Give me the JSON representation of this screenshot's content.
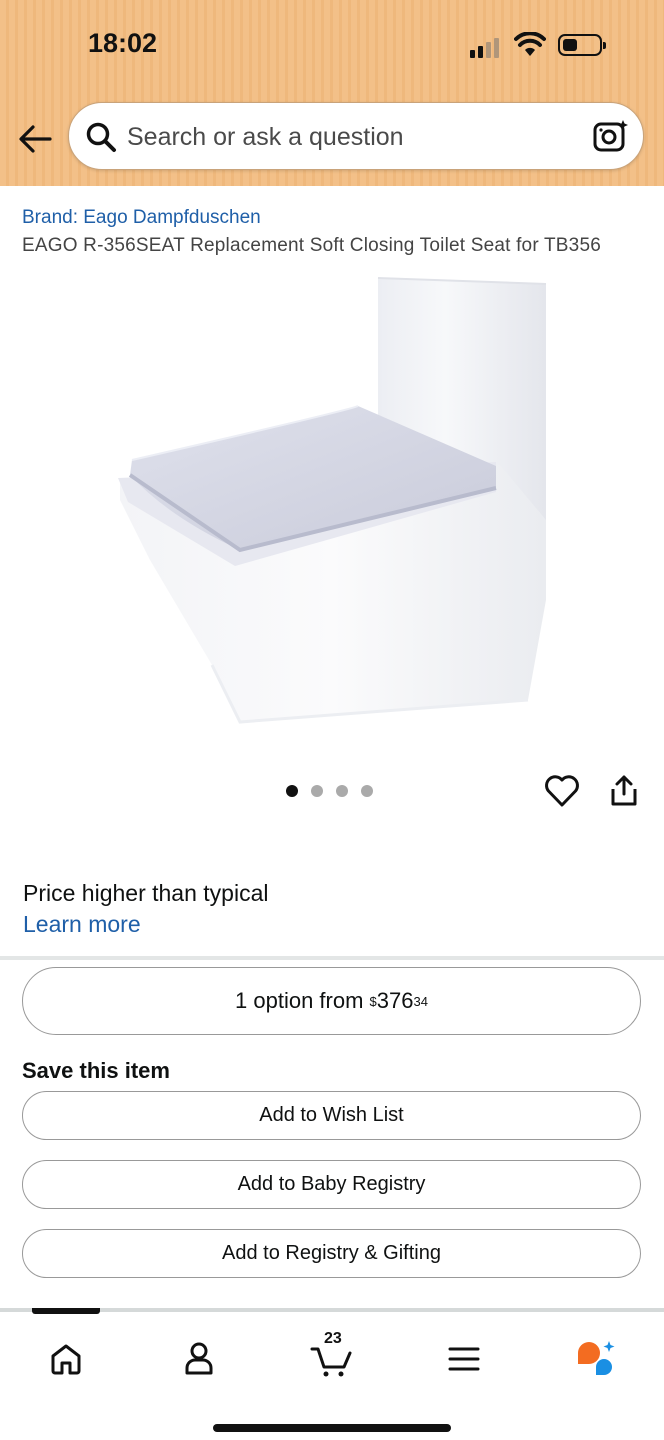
{
  "status_bar": {
    "time": "18:02"
  },
  "search": {
    "placeholder": "Search or ask a question"
  },
  "product": {
    "brand": "Brand: Eago Dampfduschen",
    "title": "EAGO R-356SEAT Replacement Soft Closing Toilet Seat for TB356",
    "image_count": 4,
    "active_image_index": 0
  },
  "price_notice": {
    "text": "Price higher than typical",
    "link": "Learn more"
  },
  "option": {
    "prefix": "1 option from ",
    "currency": "$",
    "dollars": "376",
    "cents": "34"
  },
  "save_section": {
    "heading": "Save this item",
    "buttons": [
      "Add to Wish List",
      "Add to Baby Registry",
      "Add to Registry & Gifting"
    ]
  },
  "bottom_nav": {
    "items": [
      "home-icon",
      "account-icon",
      "cart-icon",
      "menu-icon",
      "rufus-icon"
    ],
    "cart_count": "23",
    "active": "home"
  },
  "colors": {
    "header": "#f3c088",
    "link": "#1f5fa8",
    "rufus_orange": "#f36c21",
    "rufus_blue": "#1a8fe3"
  }
}
